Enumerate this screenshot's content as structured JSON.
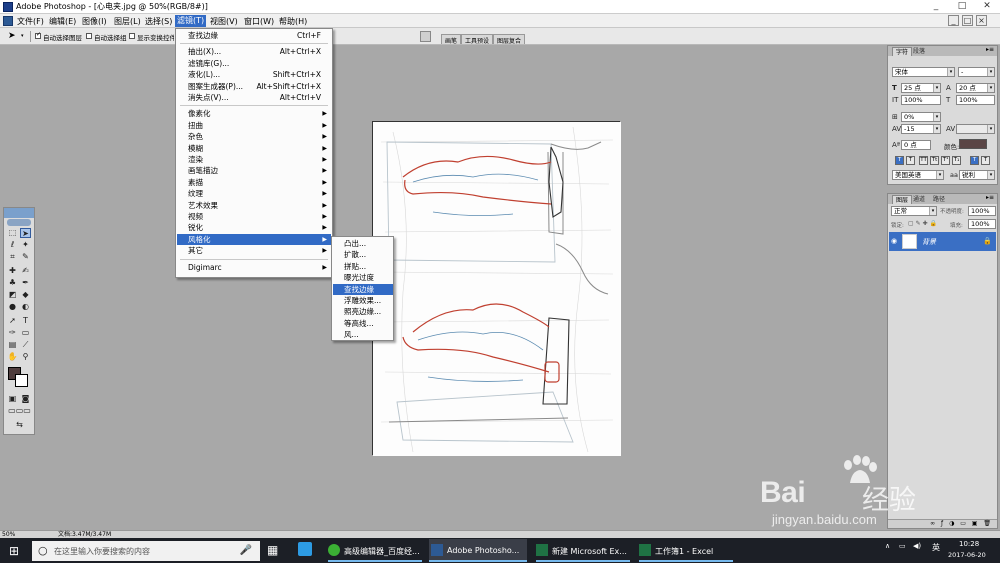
{
  "window": {
    "title": "Adobe Photoshop - [心电夹.jpg @ 50%(RGB/8#)]",
    "controls": [
      "_",
      "□",
      "✕"
    ],
    "doc_controls": [
      "_",
      "□",
      "×"
    ]
  },
  "menubar": {
    "items": [
      "文件(F)",
      "编辑(E)",
      "图像(I)",
      "图层(L)",
      "选择(S)",
      "滤镜(T)",
      "视图(V)",
      "窗口(W)",
      "帮助(H)"
    ],
    "active": "滤镜(T)"
  },
  "options": {
    "auto_select_layer": "自动选择图层",
    "auto_select_group": "自动选择组",
    "show_transform": "显示变换控件"
  },
  "palette_well": {
    "tabs": [
      "画笔",
      "工具预设",
      "图层复合"
    ]
  },
  "filter_menu": {
    "items": [
      {
        "label": "查找边缘",
        "shortcut": "Ctrl+F"
      },
      {
        "sep": true
      },
      {
        "label": "抽出(X)...",
        "shortcut": "Alt+Ctrl+X"
      },
      {
        "label": "滤镜库(G)...",
        "shortcut": ""
      },
      {
        "label": "液化(L)...",
        "shortcut": "Shift+Ctrl+X"
      },
      {
        "label": "图案生成器(P)...",
        "shortcut": "Alt+Shift+Ctrl+X"
      },
      {
        "label": "消失点(V)...",
        "shortcut": "Alt+Ctrl+V"
      },
      {
        "sep": true
      },
      {
        "label": "像素化",
        "sub": true
      },
      {
        "label": "扭曲",
        "sub": true
      },
      {
        "label": "杂色",
        "sub": true
      },
      {
        "label": "模糊",
        "sub": true
      },
      {
        "label": "渲染",
        "sub": true
      },
      {
        "label": "画笔描边",
        "sub": true
      },
      {
        "label": "素描",
        "sub": true
      },
      {
        "label": "纹理",
        "sub": true
      },
      {
        "label": "艺术效果",
        "sub": true
      },
      {
        "label": "视频",
        "sub": true
      },
      {
        "label": "锐化",
        "sub": true
      },
      {
        "label": "风格化",
        "sub": true,
        "highlight": true
      },
      {
        "label": "其它",
        "sub": true
      },
      {
        "sep": true
      },
      {
        "label": "Digimarc",
        "sub": true
      }
    ]
  },
  "stylize_submenu": {
    "items": [
      "凸出...",
      "扩散...",
      "拼贴...",
      "曝光过度",
      "查找边缘",
      "浮雕效果...",
      "照亮边缘...",
      "等高线...",
      "风..."
    ],
    "highlight": "查找边缘"
  },
  "character_panel": {
    "tabs": [
      "字符",
      "段落"
    ],
    "font_family": "宋体",
    "font_style": "-",
    "size": "25 点",
    "leading": "20 点",
    "vscale": "100%",
    "hscale": "100%",
    "tracking_label": "0%",
    "kerning": "-15",
    "baseline": "0 点",
    "color_label": "颜色:",
    "language": "美国英语",
    "aa_label": "aa",
    "antialias": "锐利",
    "color": "#5a4545"
  },
  "layers_panel": {
    "tabs": [
      "图层",
      "通道",
      "路径"
    ],
    "blend_mode": "正常",
    "opacity_label": "不透明度:",
    "opacity": "100%",
    "lock_label": "锁定:",
    "fill_label": "填充:",
    "fill": "100%",
    "layer_name": "背景"
  },
  "statusbar": {
    "zoom": "50%",
    "doc_info": "文档:3.47M/3.47M"
  },
  "taskbar": {
    "search_placeholder": "在这里输入你要搜索的内容",
    "apps": [
      {
        "label": "高级编辑器_百度经...",
        "icon": "wechat-icon",
        "color": "#3bb034"
      },
      {
        "label": "Adobe Photosho...",
        "icon": "photoshop-icon",
        "color": "#2d5a94"
      },
      {
        "label": "新建 Microsoft Ex...",
        "icon": "excel-icon",
        "color": "#1f7244"
      },
      {
        "label": "工作簿1 - Excel",
        "icon": "excel-icon",
        "color": "#1f7244"
      }
    ],
    "ime": "英",
    "time": "10:28",
    "date": "2017-06-20"
  },
  "watermark": {
    "logo_text": "Bai",
    "logo_text2": "经验",
    "url": "jingyan.baidu.com"
  }
}
